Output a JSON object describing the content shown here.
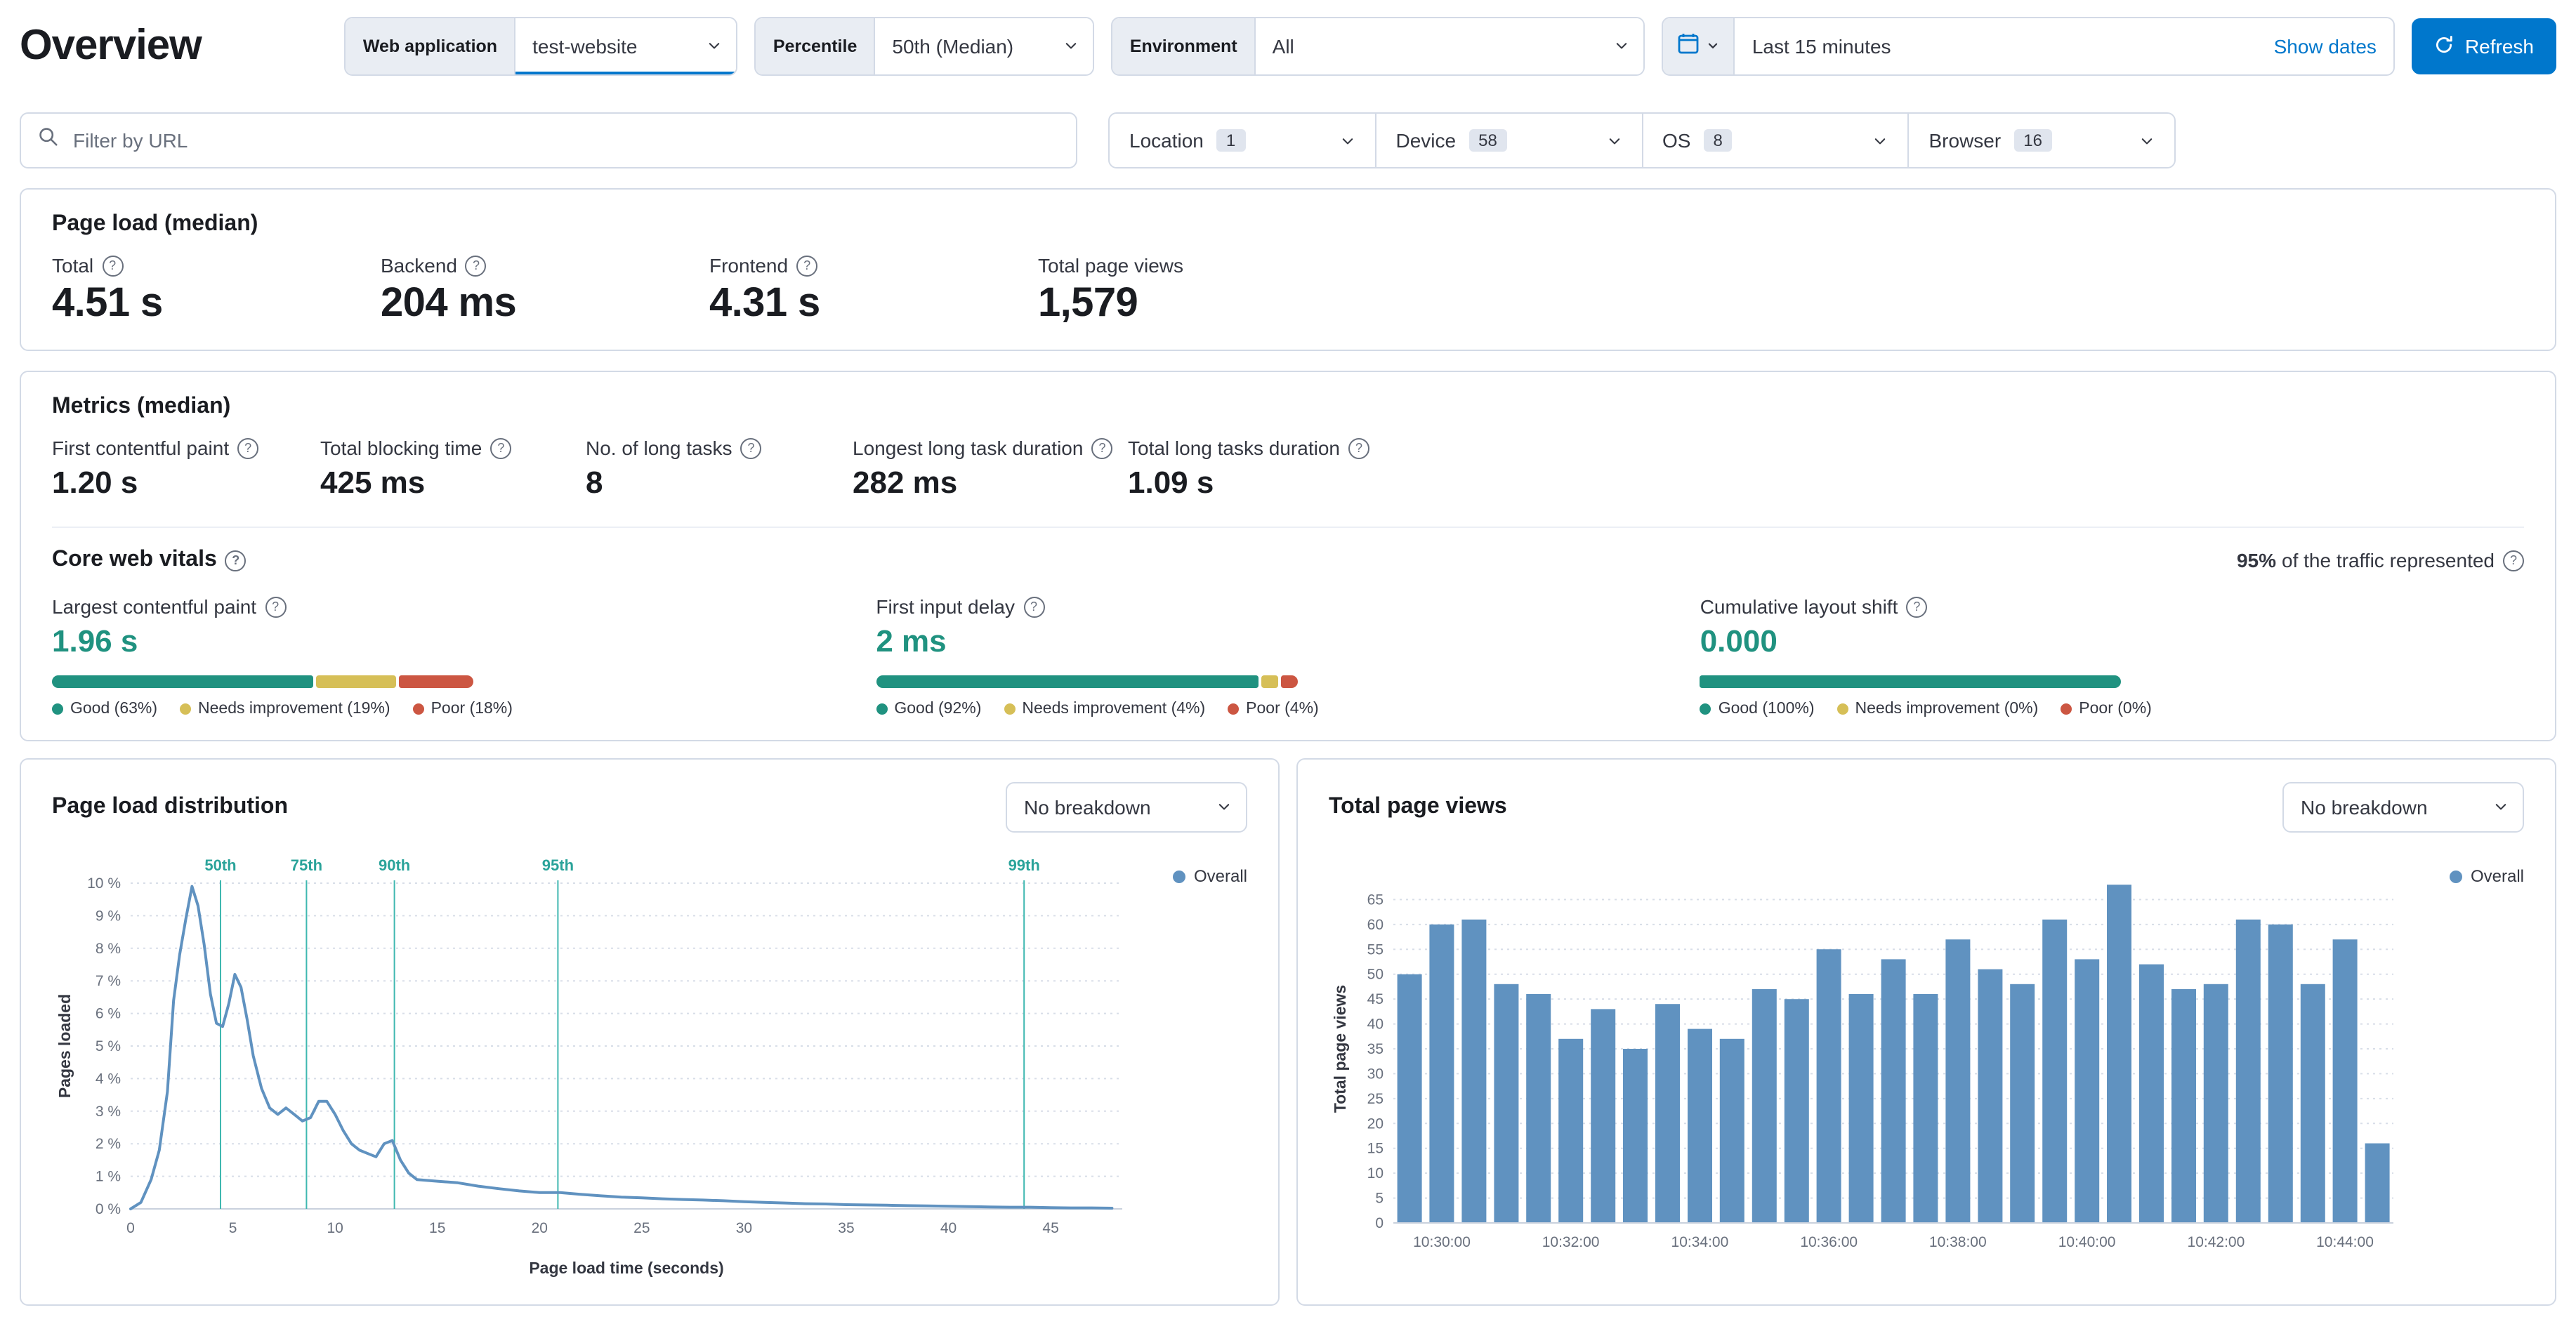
{
  "page": {
    "title": "Overview"
  },
  "header": {
    "web_app": {
      "label": "Web application",
      "value": "test-website"
    },
    "percentile": {
      "label": "Percentile",
      "value": "50th (Median)"
    },
    "environment": {
      "label": "Environment",
      "value": "All"
    },
    "datepicker": {
      "value": "Last 15 minutes",
      "show_dates_label": "Show dates"
    },
    "refresh_label": "Refresh"
  },
  "filters": {
    "url_placeholder": "Filter by URL",
    "items": [
      {
        "label": "Location",
        "count": "1"
      },
      {
        "label": "Device",
        "count": "58"
      },
      {
        "label": "OS",
        "count": "8"
      },
      {
        "label": "Browser",
        "count": "16"
      }
    ]
  },
  "page_load": {
    "title": "Page load (median)",
    "stats": [
      {
        "label": "Total",
        "value": "4.51 s"
      },
      {
        "label": "Backend",
        "value": "204 ms"
      },
      {
        "label": "Frontend",
        "value": "4.31 s"
      },
      {
        "label": "Total page views",
        "value": "1,579"
      }
    ]
  },
  "metrics": {
    "title": "Metrics (median)",
    "stats": [
      {
        "label": "First contentful paint",
        "value": "1.20 s"
      },
      {
        "label": "Total blocking time",
        "value": "425 ms"
      },
      {
        "label": "No. of long tasks",
        "value": "8"
      },
      {
        "label": "Longest long task duration",
        "value": "282 ms"
      },
      {
        "label": "Total long tasks duration",
        "value": "1.09 s"
      }
    ]
  },
  "core_web_vitals": {
    "title": "Core web vitals",
    "traffic_percent": "95%",
    "traffic_text": "of the traffic represented",
    "colors": {
      "good": "#209280",
      "average": "#D6BF57",
      "poor": "#CC5642"
    },
    "vitals": [
      {
        "label": "Largest contentful paint",
        "value": "1.96 s",
        "segments": [
          63,
          19,
          18
        ],
        "legend": [
          "Good (63%)",
          "Needs improvement (19%)",
          "Poor (18%)"
        ]
      },
      {
        "label": "First input delay",
        "value": "2 ms",
        "segments": [
          92,
          4,
          4
        ],
        "legend": [
          "Good (92%)",
          "Needs improvement (4%)",
          "Poor (4%)"
        ]
      },
      {
        "label": "Cumulative layout shift",
        "value": "0.000",
        "segments": [
          100,
          0,
          0
        ],
        "legend": [
          "Good (100%)",
          "Needs improvement (0%)",
          "Poor (0%)"
        ]
      }
    ]
  },
  "charts": {
    "series_color": "#6092C0",
    "annotation_color": "#3FB8B0",
    "distribution": {
      "title": "Page load distribution",
      "breakdown_label": "No breakdown",
      "legend": "Overall"
    },
    "page_views": {
      "title": "Total page views",
      "breakdown_label": "No breakdown",
      "legend": "Overall"
    }
  },
  "chart_data": [
    {
      "type": "line",
      "title": "Page load distribution",
      "xlabel": "Page load time (seconds)",
      "ylabel": "Pages loaded",
      "xlim": [
        0,
        48.5
      ],
      "ylim": [
        0,
        10
      ],
      "x_ticks": [
        0,
        5,
        10,
        15,
        20,
        25,
        30,
        35,
        40,
        45
      ],
      "y_ticks": [
        0,
        1,
        2,
        3,
        4,
        5,
        6,
        7,
        8,
        9,
        10
      ],
      "y_tick_suffix": " %",
      "grid": "horizontal-dotted",
      "legend_position": "right-top",
      "percentile_annotations": [
        {
          "label": "50th",
          "x": 4.4
        },
        {
          "label": "75th",
          "x": 8.6
        },
        {
          "label": "90th",
          "x": 12.9
        },
        {
          "label": "95th",
          "x": 20.9
        },
        {
          "label": "99th",
          "x": 43.7
        }
      ],
      "series": [
        {
          "name": "Overall",
          "points": [
            [
              0,
              0
            ],
            [
              0.5,
              0.2
            ],
            [
              1,
              0.9
            ],
            [
              1.4,
              1.8
            ],
            [
              1.8,
              3.6
            ],
            [
              2.1,
              6.4
            ],
            [
              2.4,
              7.8
            ],
            [
              2.7,
              8.9
            ],
            [
              3,
              9.9
            ],
            [
              3.3,
              9.3
            ],
            [
              3.6,
              8.1
            ],
            [
              3.9,
              6.6
            ],
            [
              4.2,
              5.7
            ],
            [
              4.5,
              5.6
            ],
            [
              4.8,
              6.3
            ],
            [
              5.1,
              7.2
            ],
            [
              5.4,
              6.8
            ],
            [
              5.7,
              5.8
            ],
            [
              6,
              4.7
            ],
            [
              6.4,
              3.7
            ],
            [
              6.8,
              3.1
            ],
            [
              7.2,
              2.9
            ],
            [
              7.6,
              3.1
            ],
            [
              8,
              2.9
            ],
            [
              8.4,
              2.7
            ],
            [
              8.8,
              2.8
            ],
            [
              9.2,
              3.3
            ],
            [
              9.6,
              3.3
            ],
            [
              10,
              2.9
            ],
            [
              10.4,
              2.4
            ],
            [
              10.8,
              2
            ],
            [
              11.2,
              1.8
            ],
            [
              11.6,
              1.7
            ],
            [
              12,
              1.6
            ],
            [
              12.4,
              2
            ],
            [
              12.8,
              2.1
            ],
            [
              13.2,
              1.5
            ],
            [
              13.6,
              1.1
            ],
            [
              14,
              0.9
            ],
            [
              15,
              0.85
            ],
            [
              16,
              0.8
            ],
            [
              17,
              0.7
            ],
            [
              18,
              0.62
            ],
            [
              19,
              0.55
            ],
            [
              20,
              0.5
            ],
            [
              21,
              0.5
            ],
            [
              22,
              0.45
            ],
            [
              23,
              0.4
            ],
            [
              24,
              0.36
            ],
            [
              25,
              0.34
            ],
            [
              26,
              0.31
            ],
            [
              27,
              0.29
            ],
            [
              28,
              0.27
            ],
            [
              29,
              0.25
            ],
            [
              30,
              0.22
            ],
            [
              31,
              0.2
            ],
            [
              32,
              0.18
            ],
            [
              33,
              0.16
            ],
            [
              34,
              0.15
            ],
            [
              35,
              0.13
            ],
            [
              36,
              0.12
            ],
            [
              37,
              0.11
            ],
            [
              38,
              0.1
            ],
            [
              39,
              0.09
            ],
            [
              40,
              0.08
            ],
            [
              41,
              0.07
            ],
            [
              42,
              0.06
            ],
            [
              43,
              0.05
            ],
            [
              44,
              0.05
            ],
            [
              45,
              0.04
            ],
            [
              46,
              0.03
            ],
            [
              47,
              0.03
            ],
            [
              48,
              0.02
            ]
          ]
        }
      ]
    },
    {
      "type": "bar",
      "title": "Total page views",
      "xlabel": "",
      "ylabel": "Total page views",
      "ylim": [
        0,
        70
      ],
      "y_ticks": [
        0,
        5,
        10,
        15,
        20,
        25,
        30,
        35,
        40,
        45,
        50,
        55,
        60,
        65
      ],
      "grid": "horizontal-dotted",
      "legend_position": "right-top",
      "categories": [
        "10:29:30",
        "10:30:00",
        "10:30:30",
        "10:31:00",
        "10:31:30",
        "10:32:00",
        "10:32:30",
        "10:33:00",
        "10:33:30",
        "10:34:00",
        "10:34:30",
        "10:35:00",
        "10:35:30",
        "10:36:00",
        "10:36:30",
        "10:37:00",
        "10:37:30",
        "10:38:00",
        "10:38:30",
        "10:39:00",
        "10:39:30",
        "10:40:00",
        "10:40:30",
        "10:41:00",
        "10:41:30",
        "10:42:00",
        "10:42:30",
        "10:43:00",
        "10:43:30",
        "10:44:00",
        "10:44:30"
      ],
      "x_tick_indices": [
        1,
        5,
        9,
        13,
        17,
        21,
        25,
        29
      ],
      "series": [
        {
          "name": "Overall",
          "values": [
            50,
            60,
            61,
            48,
            46,
            37,
            43,
            35,
            44,
            39,
            37,
            47,
            45,
            55,
            46,
            53,
            46,
            57,
            51,
            48,
            61,
            53,
            68,
            52,
            47,
            48,
            61,
            60,
            48,
            57,
            16
          ]
        }
      ]
    }
  ]
}
